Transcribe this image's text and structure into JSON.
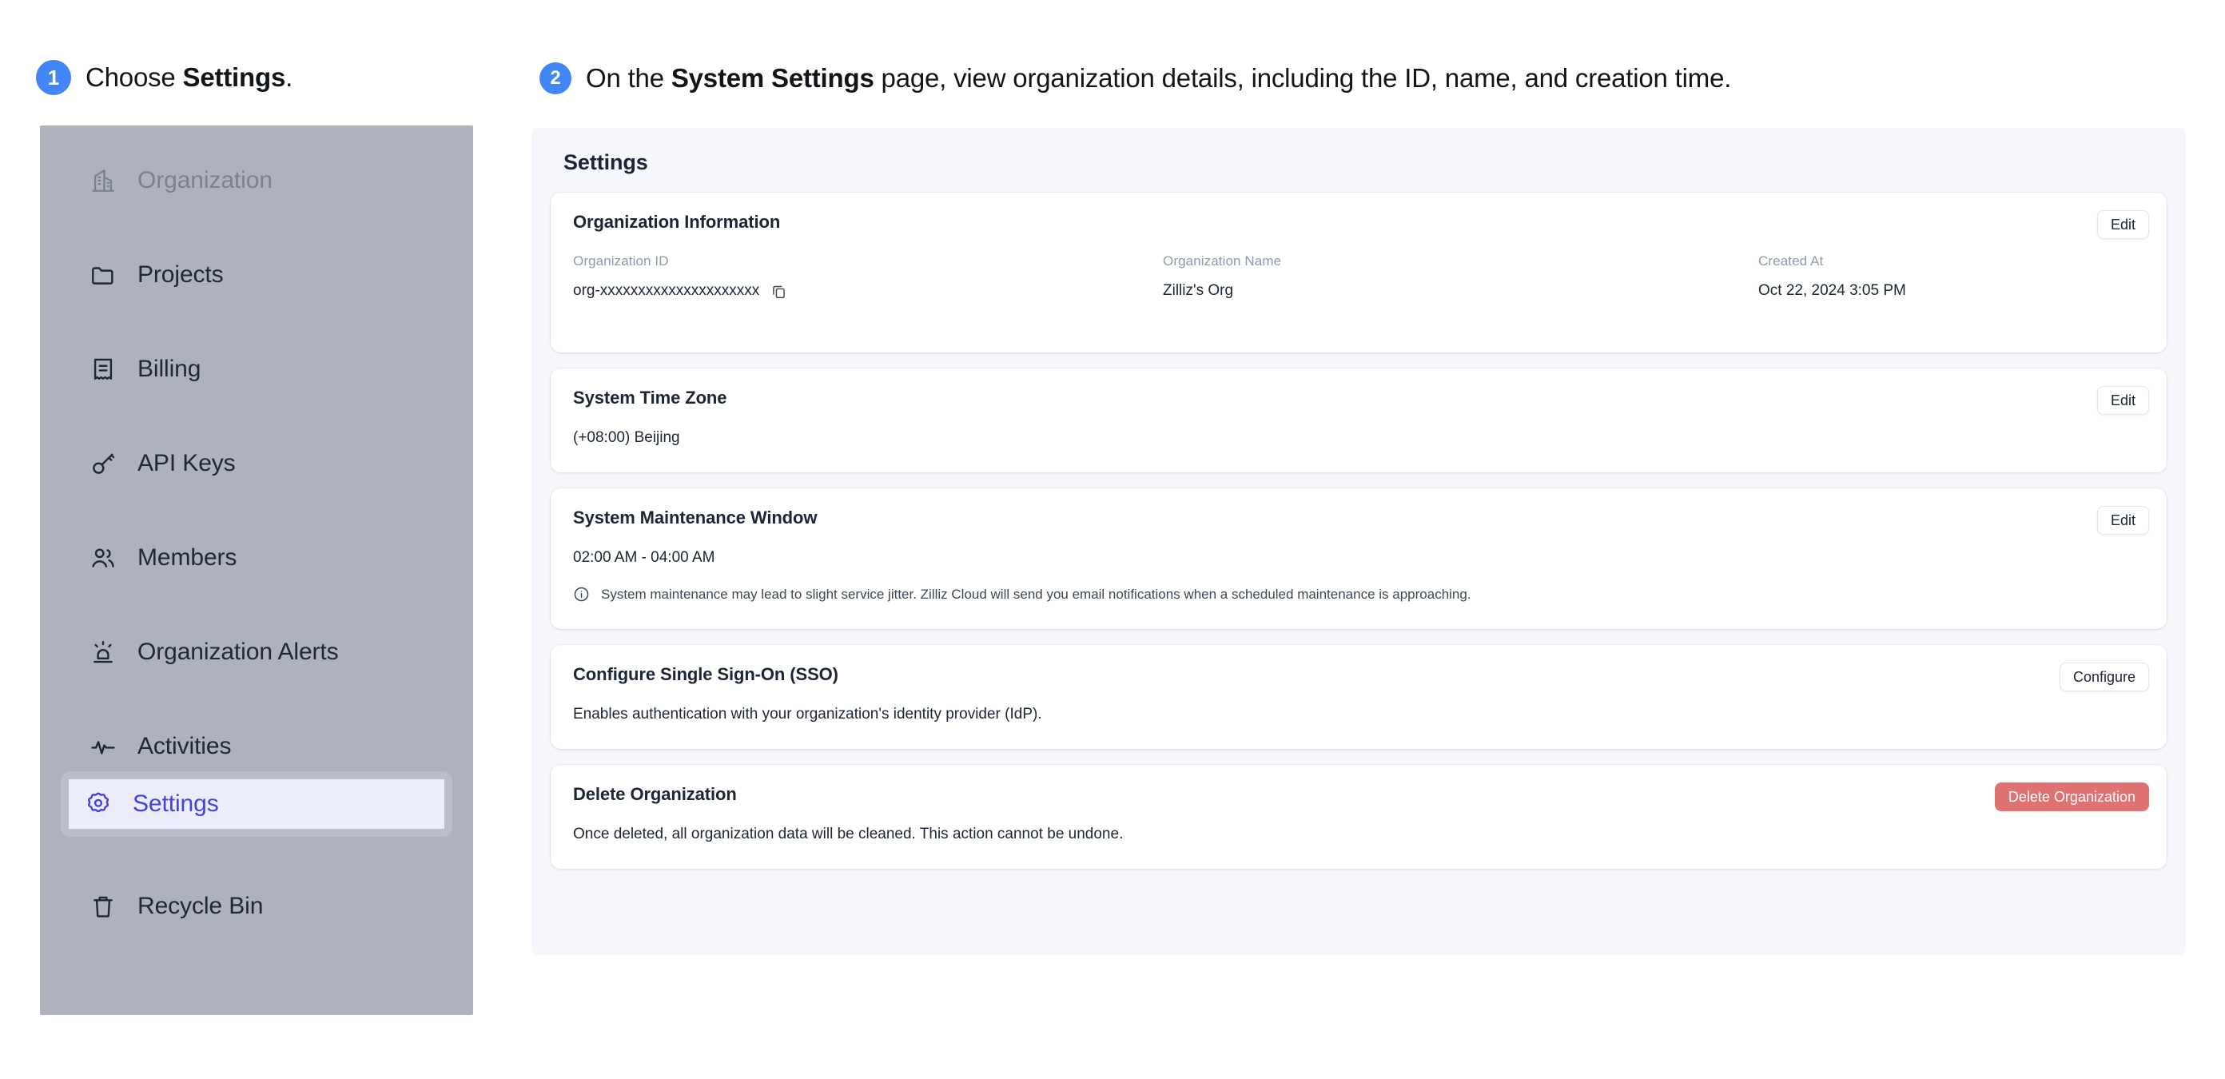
{
  "steps": [
    {
      "number": "1",
      "prefix": "Choose ",
      "bold": "Settings",
      "suffix": "."
    },
    {
      "number": "2",
      "prefix": "On the ",
      "bold": "System Settings",
      "suffix": " page, view organization details, including the ID, name, and creation time."
    }
  ],
  "sidebar": {
    "items": [
      {
        "label": "Organization",
        "icon": "building-icon",
        "state": "dim"
      },
      {
        "label": "Projects",
        "icon": "folder-icon",
        "state": "normal"
      },
      {
        "label": "Billing",
        "icon": "receipt-icon",
        "state": "normal"
      },
      {
        "label": "API Keys",
        "icon": "key-icon",
        "state": "normal"
      },
      {
        "label": "Members",
        "icon": "users-icon",
        "state": "normal"
      },
      {
        "label": "Organization Alerts",
        "icon": "alarm-icon",
        "state": "normal"
      },
      {
        "label": "Activities",
        "icon": "activity-icon",
        "state": "normal"
      },
      {
        "label": "Settings",
        "icon": "gear-icon",
        "state": "active"
      },
      {
        "label": "Recycle Bin",
        "icon": "trash-icon",
        "state": "normal"
      }
    ]
  },
  "panel": {
    "title": "Settings",
    "cards": {
      "org_info": {
        "title": "Organization Information",
        "action": "Edit",
        "fields": [
          {
            "label": "Organization ID",
            "value": "org-xxxxxxxxxxxxxxxxxxxxx",
            "copy": true
          },
          {
            "label": "Organization Name",
            "value": "Zilliz's Org"
          },
          {
            "label": "Created At",
            "value": "Oct 22, 2024 3:05 PM"
          }
        ]
      },
      "time_zone": {
        "title": "System Time Zone",
        "action": "Edit",
        "value": "(+08:00) Beijing"
      },
      "maintenance": {
        "title": "System Maintenance Window",
        "action": "Edit",
        "value": "02:00 AM - 04:00 AM",
        "note": "System maintenance may lead to slight service jitter. Zilliz Cloud will send you email notifications when a scheduled maintenance is approaching."
      },
      "sso": {
        "title": "Configure Single Sign-On (SSO)",
        "action": "Configure",
        "description": "Enables authentication with your organization's identity provider (IdP)."
      },
      "delete_org": {
        "title": "Delete Organization",
        "action": "Delete Organization",
        "description": "Once deleted, all organization data will be cleaned. This action cannot be undone."
      }
    }
  },
  "colors": {
    "accent_blue": "#4285f4",
    "active_violet": "#4540e1",
    "sidebar_gray": "#adb2bd",
    "panel_bg": "#f5f7fc",
    "danger_red": "#e07372"
  }
}
